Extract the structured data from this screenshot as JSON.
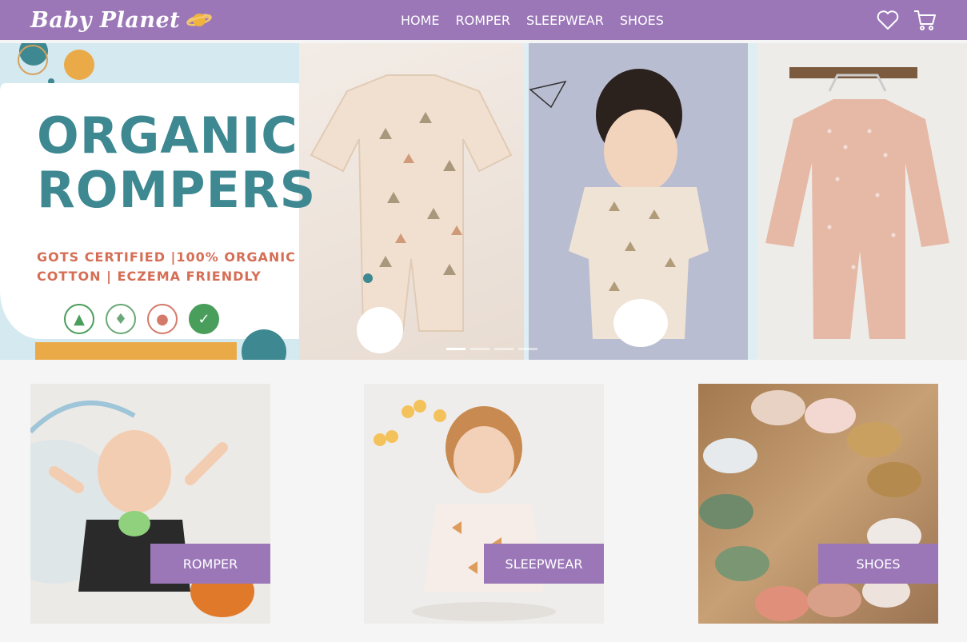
{
  "nav": {
    "logo_text": "Baby Planet",
    "menu": [
      {
        "label": "HOME"
      },
      {
        "label": "ROMPER"
      },
      {
        "label": "SLEEPWEAR"
      },
      {
        "label": "SHOES"
      }
    ],
    "icons": [
      "heart-icon",
      "cart-icon"
    ]
  },
  "hero": {
    "headline_line1": "ORGANIC",
    "headline_line2": "ROMPERS",
    "subline1": "GOTS CERTIFIED |100% ORGANIC",
    "subline2": "COTTON | ECZEMA FRIENDLY",
    "slides": 4,
    "active_slide": 1
  },
  "categories": [
    {
      "label": "ROMPER"
    },
    {
      "label": "SLEEPWEAR"
    },
    {
      "label": "SHOES"
    }
  ],
  "colors": {
    "brand": "#9b77b8",
    "headline": "#3e8892",
    "subline": "#d56e55",
    "accent_orange": "#ebaa48",
    "page_bg": "#f5f5f5"
  }
}
